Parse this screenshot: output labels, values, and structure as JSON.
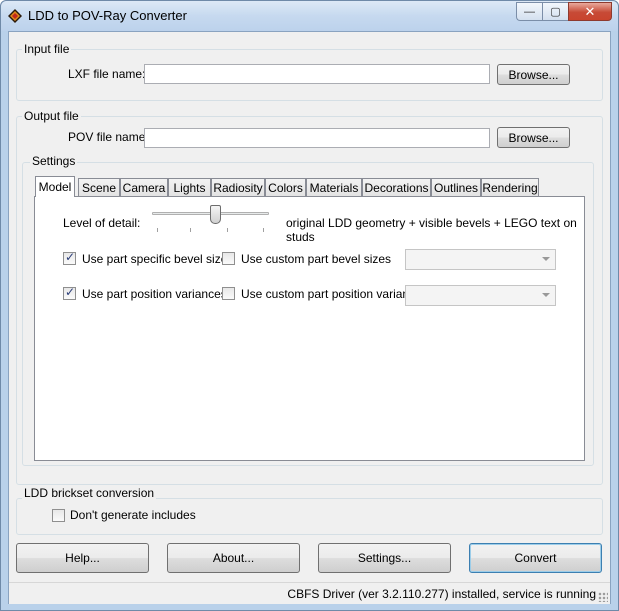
{
  "window": {
    "title": "LDD to POV-Ray Converter",
    "caption": {
      "minimize": "—",
      "maximize": "▢",
      "close": "✕"
    }
  },
  "input_group": {
    "label": "Input file",
    "field_label": "LXF file name:",
    "value": "",
    "browse": "Browse..."
  },
  "output_group": {
    "label": "Output file",
    "field_label": "POV file name:",
    "value": "",
    "browse": "Browse..."
  },
  "settings_group": {
    "label": "Settings",
    "tabs": [
      "Model",
      "Scene",
      "Camera",
      "Lights",
      "Radiosity",
      "Colors",
      "Materials",
      "Decorations",
      "Outlines",
      "Rendering"
    ],
    "active_tab": "Model",
    "model": {
      "level_of_detail_label": "Level of detail:",
      "level_of_detail_value": 0.55,
      "level_of_detail_text": "original LDD geometry + visible bevels + LEGO text on studs",
      "check_bevel_specific": {
        "label": "Use part specific bevel sizes",
        "checked": true
      },
      "check_bevel_custom": {
        "label": "Use custom part bevel sizes",
        "checked": false
      },
      "combo_bevel_value": "",
      "check_position_variances": {
        "label": "Use part position variances",
        "checked": true
      },
      "check_custom_position_variances": {
        "label": "Use custom part position variances",
        "checked": false
      },
      "combo_position_value": ""
    }
  },
  "brickset_group": {
    "label": "LDD brickset conversion",
    "check_dont_generate": {
      "label": "Don't generate includes",
      "checked": false
    }
  },
  "buttons": {
    "help": "Help...",
    "about": "About...",
    "settings": "Settings...",
    "convert": "Convert"
  },
  "status": {
    "text": "CBFS Driver (ver 3.2.110.277) installed, service is running"
  }
}
